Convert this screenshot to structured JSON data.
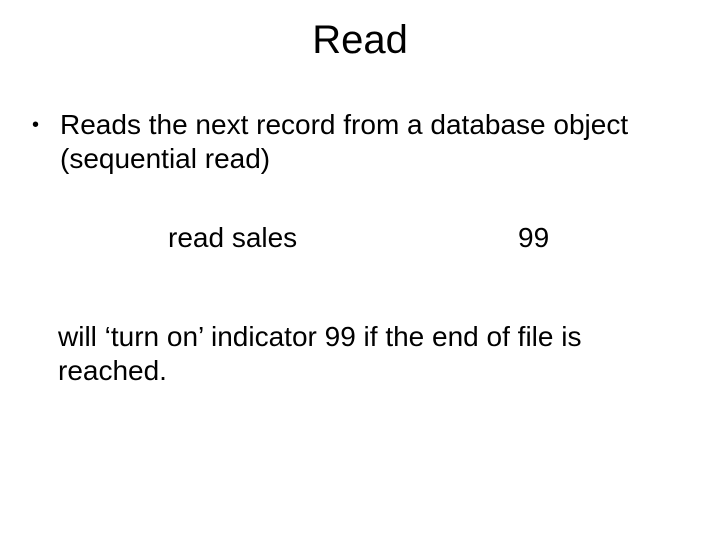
{
  "title": "Read",
  "bullet": {
    "dot": "•",
    "text": "Reads the next record from a database object (sequential read)"
  },
  "code": {
    "command": "read sales",
    "indicator": "99"
  },
  "closing": "will ‘turn on’ indicator 99 if the end of file is reached."
}
